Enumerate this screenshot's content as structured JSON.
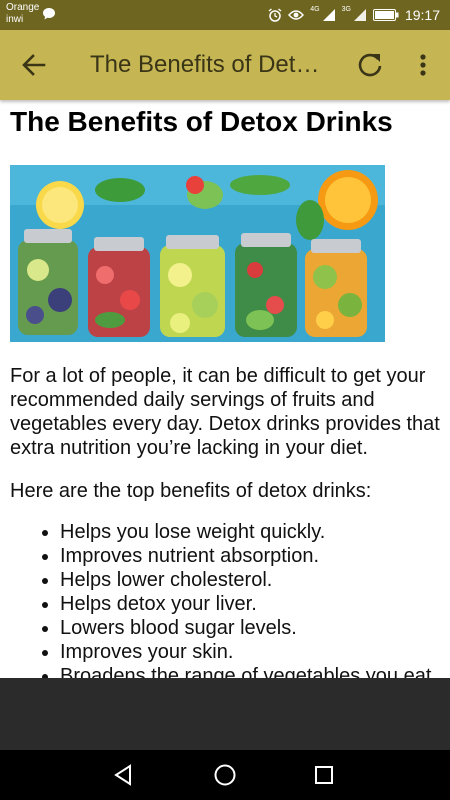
{
  "status_bar": {
    "carrier_line1": "Orange",
    "carrier_line2": "inwi",
    "network_1": "4G",
    "network_2": "3G",
    "time": "19:17"
  },
  "toolbar": {
    "title": "The Benefits of Detox Drinks"
  },
  "article": {
    "title": "The Benefits of Detox Drinks",
    "intro": "For a lot of people, it can be difficult to get your recommended daily servings of fruits and vegetables every day. Detox drinks provides that extra nutrition you’re lacking in your diet.",
    "lead": "Here are the top benefits of detox drinks:",
    "benefits": [
      "Helps you lose weight quickly.",
      "Improves nutrient absorption.",
      "Helps lower cholesterol.",
      "Helps detox your liver.",
      "Lowers blood sugar levels.",
      "Improves your skin.",
      "Broadens the range of vegetables you eat."
    ]
  },
  "colors": {
    "status_bar": "#6e6520",
    "toolbar": "#c6b653",
    "toolbar_text": "#3a3517",
    "bottom_panel": "#2b2b2b",
    "nav_bar": "#000000"
  }
}
